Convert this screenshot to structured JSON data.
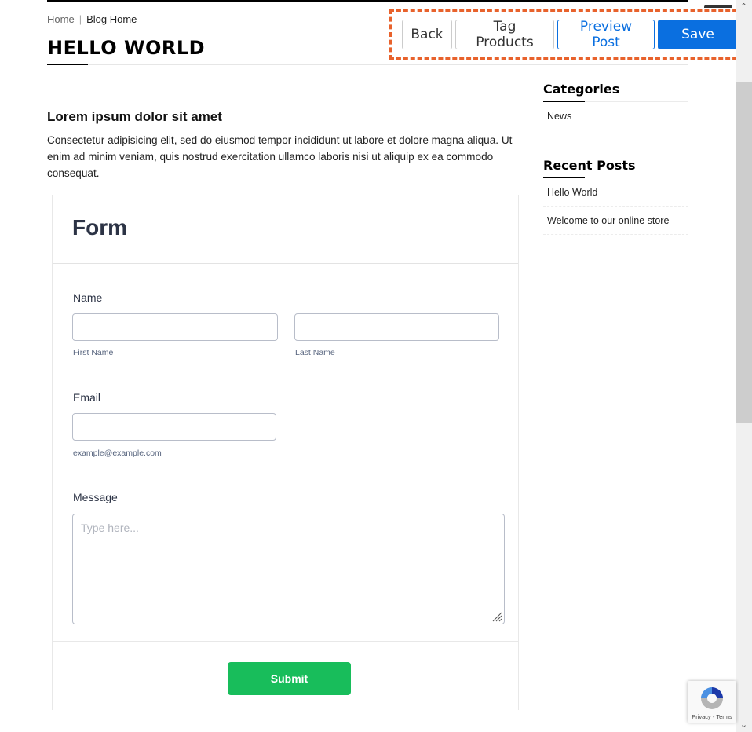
{
  "breadcrumb": {
    "home": "Home",
    "separator": "|",
    "current": "Blog Home"
  },
  "page_title": "HELLO WORLD",
  "toolbar": {
    "back_label": "Back",
    "tag_products_label": "Tag Products",
    "preview_post_label": "Preview Post",
    "save_label": "Save",
    "highlight_color": "#e8622c",
    "primary_color": "#0a6fe0"
  },
  "post": {
    "heading": "Lorem ipsum dolor sit amet",
    "body": "Consectetur adipisicing elit, sed do eiusmod tempor incididunt ut labore et dolore magna aliqua. Ut enim ad minim veniam, quis nostrud exercitation ullamco laboris nisi ut aliquip ex ea commodo consequat."
  },
  "form": {
    "title": "Form",
    "name_label": "Name",
    "first_name_sublabel": "First Name",
    "last_name_sublabel": "Last Name",
    "first_name_value": "",
    "last_name_value": "",
    "email_label": "Email",
    "email_sublabel": "example@example.com",
    "email_value": "",
    "message_label": "Message",
    "message_placeholder": "Type here...",
    "submit_label": "Submit",
    "submit_color": "#18bd5b"
  },
  "sidebar": {
    "categories_title": "Categories",
    "categories": [
      {
        "label": "News"
      }
    ],
    "recent_title": "Recent Posts",
    "recent_posts": [
      {
        "label": "Hello World"
      },
      {
        "label": "Welcome to our online store"
      }
    ]
  },
  "recaptcha": {
    "icon": "recaptcha-icon",
    "terms": "Privacy - Terms"
  },
  "scrollbar": {
    "up_icon": "chevron-up-icon",
    "down_icon": "chevron-down-icon"
  }
}
